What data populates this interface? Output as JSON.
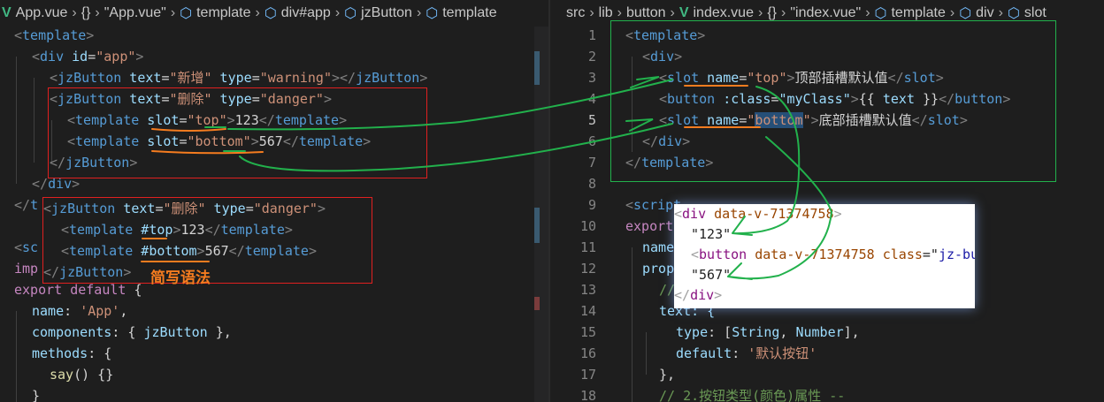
{
  "left": {
    "breadcrumb": [
      "App.vue",
      "{}",
      "\"App.vue\"",
      "template",
      "div#app",
      "jzButton",
      "template"
    ],
    "lines": [
      {
        "i": 0,
        "t": [
          [
            "<",
            "b"
          ],
          [
            "template",
            "t"
          ],
          [
            ">",
            "b"
          ]
        ]
      },
      {
        "i": 1,
        "t": [
          [
            "<",
            "b"
          ],
          [
            "div",
            "t"
          ],
          [
            " id",
            "a"
          ],
          [
            "=",
            "x"
          ],
          [
            "\"app\"",
            "s"
          ],
          [
            ">",
            "b"
          ]
        ]
      },
      {
        "i": 2,
        "t": [
          [
            "<",
            "b"
          ],
          [
            "jzButton",
            "t"
          ],
          [
            " text",
            "a"
          ],
          [
            "=",
            "x"
          ],
          [
            "\"新增\"",
            "s"
          ],
          [
            " type",
            "a"
          ],
          [
            "=",
            "x"
          ],
          [
            "\"warning\"",
            "s"
          ],
          [
            "></",
            "b"
          ],
          [
            "jzButton",
            "t"
          ],
          [
            ">",
            "b"
          ]
        ]
      },
      {
        "i": 2,
        "t": [
          [
            "<",
            "b"
          ],
          [
            "jzButton",
            "t"
          ],
          [
            " text",
            "a"
          ],
          [
            "=",
            "x"
          ],
          [
            "\"删除\"",
            "s"
          ],
          [
            " type",
            "a"
          ],
          [
            "=",
            "x"
          ],
          [
            "\"danger\"",
            "s"
          ],
          [
            ">",
            "b"
          ]
        ]
      },
      {
        "i": 3,
        "t": [
          [
            "<",
            "b"
          ],
          [
            "template",
            "t"
          ],
          [
            " slot",
            "a"
          ],
          [
            "=",
            "x"
          ],
          [
            "\"top\"",
            "s"
          ],
          [
            ">",
            "b"
          ],
          [
            "123",
            "x"
          ],
          [
            "</",
            "b"
          ],
          [
            "template",
            "t"
          ],
          [
            ">",
            "b"
          ]
        ]
      },
      {
        "i": 3,
        "t": [
          [
            "<",
            "b"
          ],
          [
            "template",
            "t"
          ],
          [
            " slot",
            "a"
          ],
          [
            "=",
            "x"
          ],
          [
            "\"bottom\"",
            "s"
          ],
          [
            ">",
            "b"
          ],
          [
            "567",
            "x"
          ],
          [
            "</",
            "b"
          ],
          [
            "template",
            "t"
          ],
          [
            ">",
            "b"
          ]
        ]
      },
      {
        "i": 2,
        "t": [
          [
            "</",
            "b"
          ],
          [
            "jzButton",
            "t"
          ],
          [
            ">",
            "b"
          ]
        ]
      },
      {
        "i": 1,
        "t": [
          [
            "</",
            "b"
          ],
          [
            "div",
            "t"
          ],
          [
            ">",
            "b"
          ]
        ]
      },
      {
        "i": 0,
        "t": [
          [
            "</",
            "b"
          ],
          [
            "t",
            "t"
          ]
        ]
      },
      {
        "i": 0,
        "t": []
      },
      {
        "i": 0,
        "t": [
          [
            "<",
            "b"
          ],
          [
            "sc",
            "t"
          ]
        ]
      },
      {
        "i": 0,
        "t": [
          [
            "imp",
            "k"
          ]
        ]
      },
      {
        "i": 0,
        "t": [
          [
            "export default",
            "k"
          ],
          [
            " {",
            "x"
          ]
        ]
      },
      {
        "i": 1,
        "t": [
          [
            "name",
            "a"
          ],
          [
            ": ",
            "x"
          ],
          [
            "'App'",
            "s"
          ],
          [
            ",",
            "x"
          ]
        ]
      },
      {
        "i": 1,
        "t": [
          [
            "components",
            "a"
          ],
          [
            ": { ",
            "x"
          ],
          [
            "jzButton",
            "a"
          ],
          [
            " },",
            "x"
          ]
        ]
      },
      {
        "i": 1,
        "t": [
          [
            "methods",
            "a"
          ],
          [
            ": {",
            "x"
          ]
        ]
      },
      {
        "i": 2,
        "t": [
          [
            "say",
            "f"
          ],
          [
            "() {}",
            "x"
          ]
        ]
      },
      {
        "i": 1,
        "t": [
          [
            "}",
            "x"
          ]
        ]
      }
    ],
    "shorthand": {
      "lines": [
        {
          "i": 0,
          "t": [
            [
              "<",
              "b"
            ],
            [
              "jzButton",
              "t"
            ],
            [
              " text",
              "a"
            ],
            [
              "=",
              "x"
            ],
            [
              "\"删除\"",
              "s"
            ],
            [
              " type",
              "a"
            ],
            [
              "=",
              "x"
            ],
            [
              "\"danger\"",
              "s"
            ],
            [
              ">",
              "b"
            ]
          ]
        },
        {
          "i": 1,
          "t": [
            [
              "<",
              "b"
            ],
            [
              "template",
              "t"
            ],
            [
              " #top",
              "a"
            ],
            [
              ">",
              "b"
            ],
            [
              "123",
              "x"
            ],
            [
              "</",
              "b"
            ],
            [
              "template",
              "t"
            ],
            [
              ">",
              "b"
            ]
          ]
        },
        {
          "i": 1,
          "t": [
            [
              "<",
              "b"
            ],
            [
              "template",
              "t"
            ],
            [
              " #bottom",
              "a"
            ],
            [
              ">",
              "b"
            ],
            [
              "567",
              "x"
            ],
            [
              "</",
              "b"
            ],
            [
              "template",
              "t"
            ],
            [
              ">",
              "b"
            ]
          ]
        },
        {
          "i": 0,
          "t": [
            [
              "</",
              "b"
            ],
            [
              "jzButton",
              "t"
            ],
            [
              ">",
              "b"
            ]
          ]
        }
      ],
      "label": "简写语法"
    }
  },
  "right": {
    "breadcrumb": [
      "src",
      "lib",
      "button",
      "index.vue",
      "{}",
      "\"index.vue\"",
      "template",
      "div",
      "slot"
    ],
    "active_line": 5,
    "lines": [
      {
        "n": "1",
        "i": 0,
        "t": [
          [
            "<",
            "b"
          ],
          [
            "template",
            "t"
          ],
          [
            ">",
            "b"
          ]
        ]
      },
      {
        "n": "2",
        "i": 1,
        "t": [
          [
            "<",
            "b"
          ],
          [
            "div",
            "t"
          ],
          [
            ">",
            "b"
          ]
        ]
      },
      {
        "n": "3",
        "i": 2,
        "t": [
          [
            "<",
            "b"
          ],
          [
            "slot",
            "t"
          ],
          [
            " name",
            "a"
          ],
          [
            "=",
            "x"
          ],
          [
            "\"top\"",
            "s"
          ],
          [
            ">",
            "b"
          ],
          [
            "顶部插槽默认值",
            "x"
          ],
          [
            "</",
            "b"
          ],
          [
            "slot",
            "t"
          ],
          [
            ">",
            "b"
          ]
        ]
      },
      {
        "n": "4",
        "i": 2,
        "t": [
          [
            "<",
            "b"
          ],
          [
            "button",
            "t"
          ],
          [
            " :class",
            "a"
          ],
          [
            "=",
            "x"
          ],
          [
            "\"myClass\"",
            "a"
          ],
          [
            ">",
            "b"
          ],
          [
            "{{ ",
            "x"
          ],
          [
            "text",
            "a"
          ],
          [
            " }}",
            "x"
          ],
          [
            "</",
            "b"
          ],
          [
            "button",
            "t"
          ],
          [
            ">",
            "b"
          ]
        ]
      },
      {
        "n": "5",
        "i": 2,
        "t": [
          [
            "<",
            "b"
          ],
          [
            "slot",
            "t"
          ],
          [
            " name",
            "a"
          ],
          [
            "=",
            "x"
          ],
          [
            "\"",
            "s"
          ],
          [
            "bottom",
            "s sel"
          ],
          [
            "\"",
            "s"
          ],
          [
            ">",
            "b"
          ],
          [
            "底部插槽默认值",
            "x"
          ],
          [
            "</",
            "b"
          ],
          [
            "slot",
            "t"
          ],
          [
            ">",
            "b"
          ]
        ]
      },
      {
        "n": "6",
        "i": 1,
        "t": [
          [
            "</",
            "b"
          ],
          [
            "div",
            "t"
          ],
          [
            ">",
            "b"
          ]
        ]
      },
      {
        "n": "7",
        "i": 0,
        "t": [
          [
            "</",
            "b"
          ],
          [
            "template",
            "t"
          ],
          [
            ">",
            "b"
          ]
        ]
      },
      {
        "n": "8",
        "i": 0,
        "t": []
      },
      {
        "n": "9",
        "i": 0,
        "t": [
          [
            "<",
            "b"
          ],
          [
            "script",
            "t"
          ]
        ]
      },
      {
        "n": "10",
        "i": 0,
        "t": [
          [
            "export",
            "k"
          ]
        ]
      },
      {
        "n": "11",
        "i": 1,
        "t": [
          [
            "name",
            "a"
          ]
        ]
      },
      {
        "n": "12",
        "i": 1,
        "t": [
          [
            "prop",
            "a"
          ]
        ]
      },
      {
        "n": "13",
        "i": 2,
        "t": [
          [
            "//",
            "c"
          ]
        ]
      },
      {
        "n": "14",
        "i": 2,
        "t": [
          [
            "text: {",
            "a"
          ]
        ]
      },
      {
        "n": "15",
        "i": 3,
        "t": [
          [
            "type",
            "a"
          ],
          [
            ": [",
            "x"
          ],
          [
            "String",
            "a"
          ],
          [
            ", ",
            "x"
          ],
          [
            "Number",
            "a"
          ],
          [
            "],",
            "x"
          ]
        ]
      },
      {
        "n": "16",
        "i": 3,
        "t": [
          [
            "default",
            "a"
          ],
          [
            ": ",
            "x"
          ],
          [
            "'默认按钮'",
            "s"
          ]
        ]
      },
      {
        "n": "17",
        "i": 2,
        "t": [
          [
            "},",
            "x"
          ]
        ]
      },
      {
        "n": "18",
        "i": 2,
        "t": [
          [
            "// 2.按钮类型(颜色)属性 --",
            "c"
          ]
        ]
      }
    ]
  },
  "devtools_popup": {
    "lines": [
      {
        "i": 0,
        "t": [
          [
            "<",
            "pb"
          ],
          [
            "div",
            "pt"
          ],
          [
            " data-v-71374758",
            "pa"
          ],
          [
            ">",
            "pb"
          ]
        ]
      },
      {
        "i": 1,
        "t": [
          [
            "\"123\"",
            "ps"
          ]
        ]
      },
      {
        "i": 1,
        "t": [
          [
            "<",
            "pb"
          ],
          [
            "button",
            "pt"
          ],
          [
            " data-v-71374758",
            "pa"
          ],
          [
            " class",
            "pa"
          ],
          [
            "=\"",
            "ps"
          ],
          [
            "jz-bu",
            "pv"
          ]
        ]
      },
      {
        "i": 1,
        "t": [
          [
            "\"567\"",
            "ps"
          ]
        ]
      },
      {
        "i": 0,
        "t": [
          [
            "</",
            "pb"
          ],
          [
            "div",
            "pt"
          ],
          [
            ">",
            "pb"
          ]
        ]
      }
    ]
  },
  "colors": {
    "annotation_green": "#22b14c",
    "annotation_orange": "#f57c1f",
    "annotation_red": "#e02020"
  }
}
